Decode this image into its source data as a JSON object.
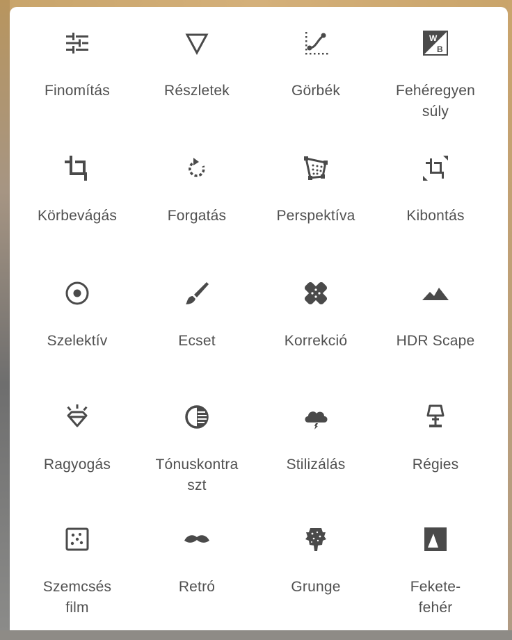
{
  "tools": [
    {
      "id": "finomitas",
      "label": "Finomítás",
      "icon": "tune-sliders-icon"
    },
    {
      "id": "reszletek",
      "label": "Részletek",
      "icon": "triangle-details-icon"
    },
    {
      "id": "gorbek",
      "label": "Görbék",
      "icon": "curves-icon"
    },
    {
      "id": "feheregyensuly",
      "label_line1": "Fehéregyen",
      "label_line2": "súly",
      "icon": "white-balance-icon"
    },
    {
      "id": "korbevagas",
      "label": "Körbevágás",
      "icon": "crop-icon"
    },
    {
      "id": "forgatas",
      "label": "Forgatás",
      "icon": "rotate-icon"
    },
    {
      "id": "perspektiva",
      "label": "Perspektíva",
      "icon": "perspective-icon"
    },
    {
      "id": "kibontas",
      "label": "Kibontás",
      "icon": "expand-icon"
    },
    {
      "id": "szelektiv",
      "label": "Szelektív",
      "icon": "selective-icon"
    },
    {
      "id": "ecset",
      "label": "Ecset",
      "icon": "brush-icon"
    },
    {
      "id": "korrekcio",
      "label": "Korrekció",
      "icon": "healing-icon"
    },
    {
      "id": "hdrscape",
      "label": "HDR Scape",
      "icon": "mountains-icon"
    },
    {
      "id": "ragyogas",
      "label": "Ragyogás",
      "icon": "glamour-glow-icon"
    },
    {
      "id": "tonuskontraszt",
      "label_line1": "Tónuskontra",
      "label_line2": "szt",
      "icon": "tonal-contrast-icon"
    },
    {
      "id": "stilizalas",
      "label": "Stilizálás",
      "icon": "drama-cloud-icon"
    },
    {
      "id": "regies",
      "label": "Régies",
      "icon": "vintage-lamp-icon"
    },
    {
      "id": "szemcses",
      "label_line1": "Szemcsés",
      "label_line2": "film",
      "icon": "grainy-film-icon"
    },
    {
      "id": "retro",
      "label": "Retró",
      "icon": "mustache-icon"
    },
    {
      "id": "grunge",
      "label": "Grunge",
      "icon": "grunge-icon"
    },
    {
      "id": "feketefeher",
      "label_line1": "Fekete-",
      "label_line2": "fehér",
      "icon": "black-white-icon"
    }
  ],
  "colors": {
    "icon": "#4a4a4a",
    "label": "#505050",
    "panel": "#ffffff"
  }
}
